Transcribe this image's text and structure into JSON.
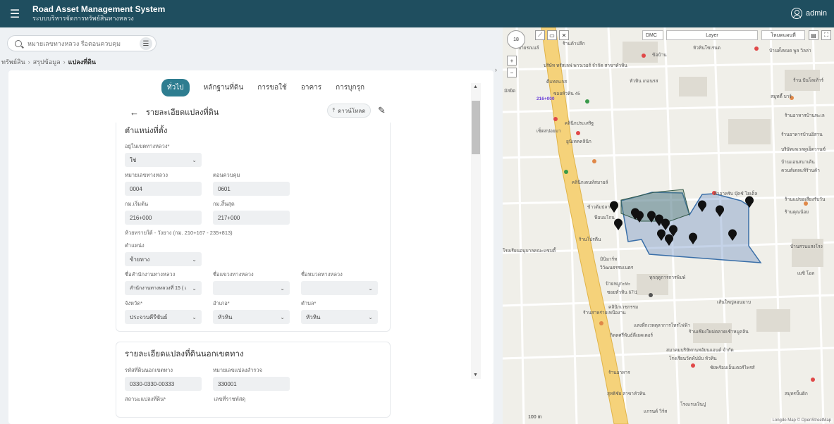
{
  "header": {
    "menu_icon": "menu-icon",
    "title": "Road Asset Management System",
    "subtitle": "ระบบบริหารจัดการทรัพย์สินทางหลวง",
    "user": "admin",
    "bg_color": "#1f4e5f"
  },
  "search": {
    "placeholder": "หมายเลขทางหลวง รือตอนควบคุม"
  },
  "breadcrumb": [
    "ทรัพย์สิน",
    "สรุปข้อมูล",
    "แปลงที่ดิน"
  ],
  "tabs": [
    "ทั่วไป",
    "หลักฐานที่ดิน",
    "การขอใช้",
    "อาคาร",
    "การบุกรุก"
  ],
  "active_tab": "ทั่วไป",
  "detail": {
    "title": "รายละเอียดแปลงที่ดิน",
    "download_label": "ดาวน์โหลด"
  },
  "location_section": {
    "title": "ตำแหน่งที่ตั้ง",
    "in_highway_label": "อยู่ในเขตทางหลวง*",
    "in_highway_value": "ใช่",
    "highway_no_label": "หมายเลขทางหลวง",
    "highway_no_value": "0004",
    "control_label": "ตอนควบคุม",
    "control_value": "0601",
    "km_start_label": "กม.เริ่มต้น",
    "km_start_value": "216+000",
    "km_end_label": "กม.สิ้นสุด",
    "km_end_value": "217+000",
    "note": "ห้วยทรายใต้ - วังยาง (กม. 210+167 - 235+813)",
    "position_label": "ตำแหน่ง",
    "position_value": "ซ้ายทาง",
    "office_label": "ชื่อสำนักงานทางหลวง",
    "office_value": "สำนักงานทางหลวงที่ 15 ( เ",
    "district_office_label": "ชื่อแขวงทางหลวง",
    "district_office_value": "",
    "unit_label": "ชื่อหมวดทางหลวง",
    "unit_value": "",
    "province_label": "จังหวัด*",
    "province_value": "ประจวบคีรีขันธ์",
    "amphoe_label": "อำเภอ*",
    "amphoe_value": "หัวหิน",
    "tambon_label": "ตำบล*",
    "tambon_value": "หัวหิน"
  },
  "outside_section": {
    "title": "รายละเอียดแปลงที่ดินนอกเขตทาง",
    "code_label": "รหัสที่ดินนอกเขตทาง",
    "code_value": "0330-0330-00333",
    "survey_label": "หมายเลขแปลงสำรวจ",
    "survey_value": "330001",
    "status_label": "สถานะแปลงที่ดิน*",
    "parcel_label": "เลขที่ราชพัสดุ"
  },
  "map": {
    "zoom": "18",
    "layer_select": "Layer",
    "style_select": "DMC",
    "base_select": "โหมดแผนที่",
    "scale": "100 m",
    "attribution": "Longdo Map © OpenStreetMap",
    "labels": [
      "ร้านค้าปลีก",
      "บ้านทั้งหมด พูล วิลล่า",
      "ข้อบ้าน",
      "หัวหินโซเรนด",
      "มัสยิด",
      "ป้ายรถเมล์",
      "ร้าน ปันโลเท้าร์",
      "บริษัท ทรัสเลฟ พาวเวอร์ จำกัด สาขาหัวหิน",
      "ดีแทคแกส",
      "หัวหิน เกอนรส",
      "ซอยหัวหิน 45",
      "216+000",
      "สมูทตี้ บาร์",
      "ร้านอาหารบ้านทะเล",
      "คลินิกประเสริฐ",
      "เซ็ตสปอยมา",
      "ร้านอาหารบ้านอิสาน",
      "ยูนิเทคคลินิก",
      "บริษัทเลเวลทูเอ็ดวานซ์",
      "บ้านแอนสนาเด้น",
      "ควนส์เดลแท้ร้านค้า",
      "คลินิกเดนท์สมายล์",
      "ผ้าอาหรับ บุ๊คช์ โฮเต็ล",
      "ข้าวต้มปลา",
      "ร้านแม่ขอเสียงรับวัน",
      "ร้านคุณน้อย",
      "ฟีอบมโกน",
      "บ้านสวนแสงโรง",
      "โรงเรียนอนุบาลคณะแซมตี้",
      "มินิมาร์ท",
      "ร้านโปรตีน",
      "วิวัฒนธรรมเนตร",
      "เมซิ โอล",
      "ทุกฤดูการการพิมพ์",
      "ป้ายหมูกะทะ",
      "ซอยหัวหิน 67/1",
      "ร้านสาหร่ายเหนืองาน",
      "คลินิกเวชกรรม",
      "แสงที่กเวทตุลาการโทรไฟฟ้า",
      "ร้านเชียงใหม่ตลาดเช้าหมูคลิน",
      "กิตตศรีพันธ์ดีเยคเตอร์",
      "สมาคมบริษัทกนทอัยนแอนด์ จำกัด",
      "โรงเรียนวัดฟ์ปมับ หัวหิน",
      "เส้นใหญ่ลอนมาบ",
      "ชัยพร้อมเอ็นเตอร์ไพรส์",
      "สุทธิชัย สาขาหัวหิน",
      "ร้านอาหาร",
      "แกรนด์ วิร์ส",
      "โรงแรมเงินปู",
      "สมุทรปั้นติก"
    ],
    "pin_count": 15
  }
}
